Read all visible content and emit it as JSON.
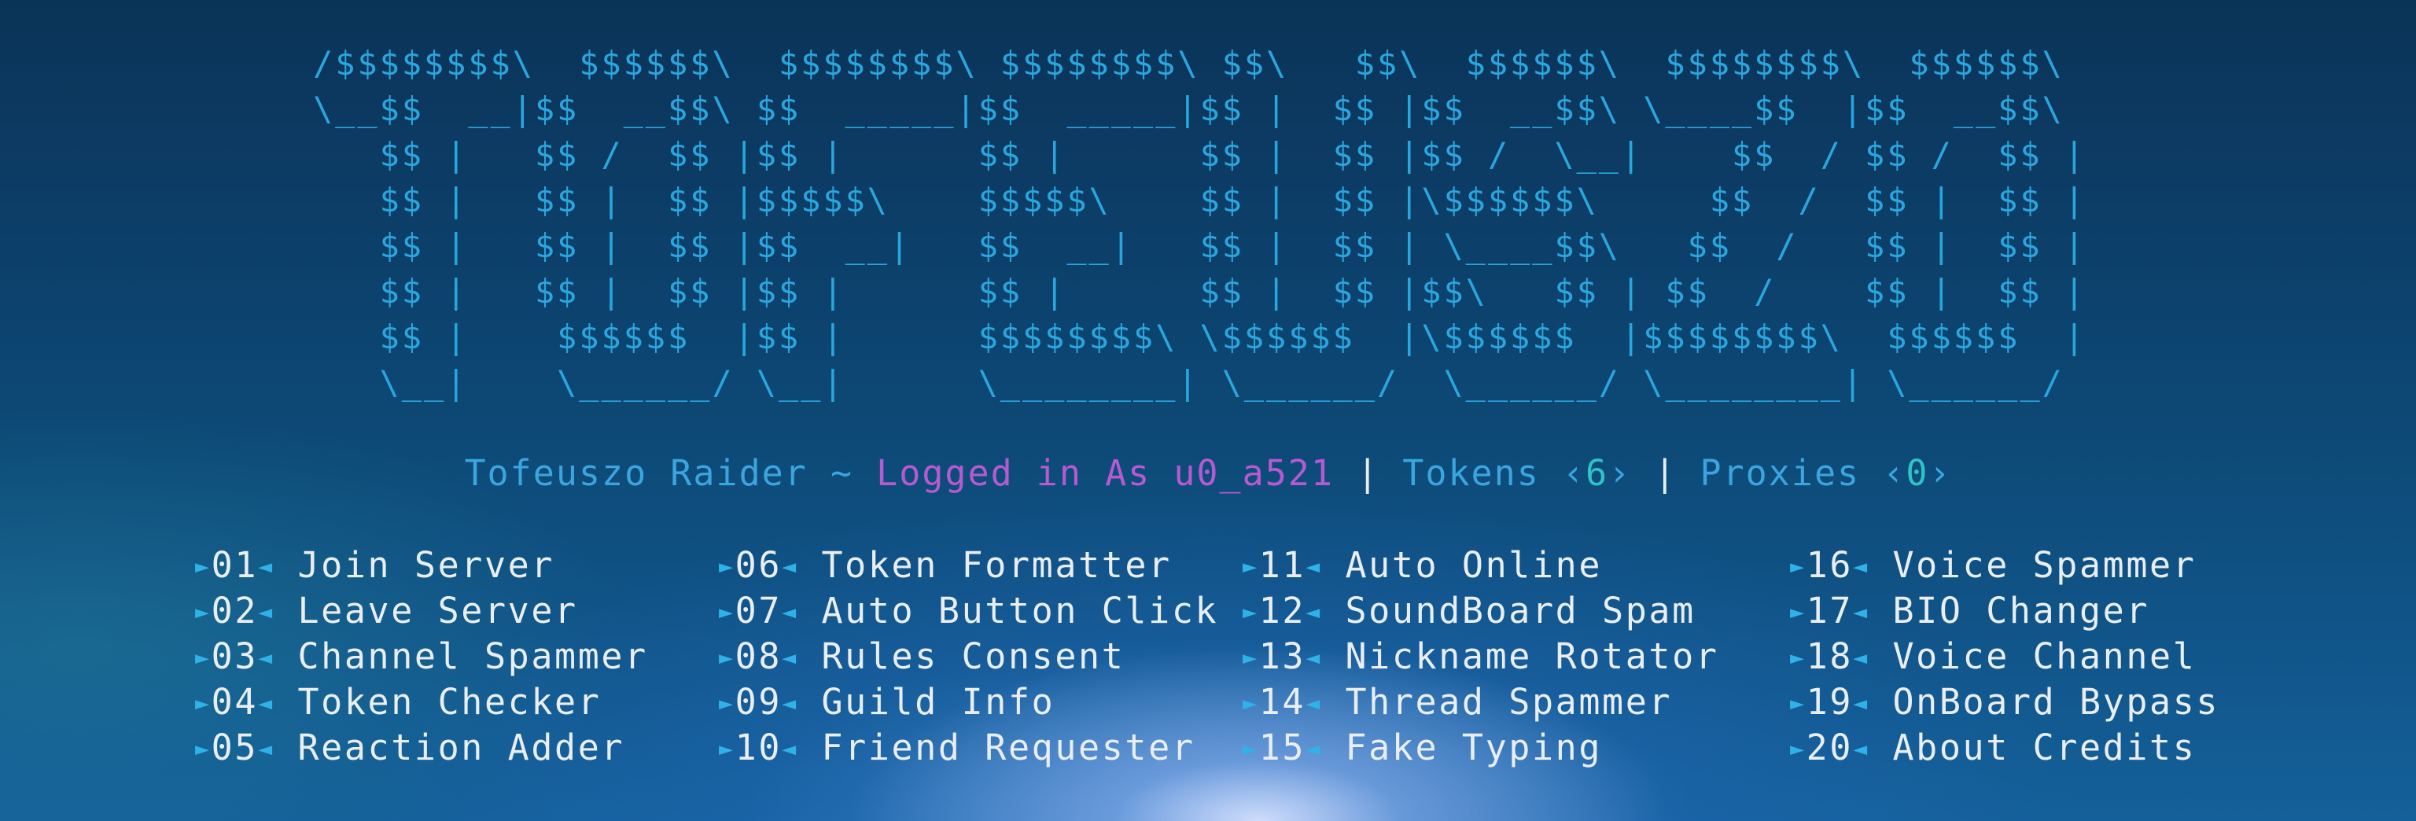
{
  "banner": {
    "lines": [
      "/$$$$$$$$\\  $$$$$$\\  $$$$$$$$\\ $$$$$$$$\\ $$\\   $$\\  $$$$$$\\  $$$$$$$$\\  $$$$$$\\",
      "\\__$$  __|$$  __$$\\ $$  _____|$$  _____|$$ |  $$ |$$  __$$\\ \\____$$  |$$  __$$\\",
      "   $$ |   $$ /  $$ |$$ |      $$ |      $$ |  $$ |$$ /  \\__|    $$  / $$ /  $$ |",
      "   $$ |   $$ |  $$ |$$$$$\\    $$$$$\\    $$ |  $$ |\\$$$$$$\\     $$  /  $$ |  $$ |",
      "   $$ |   $$ |  $$ |$$  __|   $$  __|   $$ |  $$ | \\____$$\\   $$  /   $$ |  $$ |",
      "   $$ |   $$ |  $$ |$$ |      $$ |      $$ |  $$ |$$\\   $$ | $$  /    $$ |  $$ |",
      "   $$ |    $$$$$$  |$$ |      $$$$$$$$\\ \\$$$$$$  |\\$$$$$$  |$$$$$$$$\\  $$$$$$  |",
      "   \\__|    \\______/ \\__|      \\________| \\______/  \\______/ \\________| \\______/"
    ]
  },
  "status": {
    "app_name": "Tofeuszo Raider",
    "separator_tilde": " ~ ",
    "logged_in": "Logged in As u0_a521",
    "pipe": " | ",
    "tokens_label": "Tokens ",
    "tokens_open": "‹",
    "tokens_count": "6",
    "tokens_close": "›",
    "proxies_label": "Proxies ",
    "proxies_open": "‹",
    "proxies_count": "0",
    "proxies_close": "›"
  },
  "menu": {
    "arrow_left": "►",
    "arrow_right": "◄",
    "columns": [
      [
        {
          "num": "01",
          "label": "Join Server"
        },
        {
          "num": "02",
          "label": "Leave Server"
        },
        {
          "num": "03",
          "label": "Channel Spammer"
        },
        {
          "num": "04",
          "label": "Token Checker"
        },
        {
          "num": "05",
          "label": "Reaction Adder"
        }
      ],
      [
        {
          "num": "06",
          "label": "Token Formatter"
        },
        {
          "num": "07",
          "label": "Auto Button Click"
        },
        {
          "num": "08",
          "label": "Rules Consent"
        },
        {
          "num": "09",
          "label": "Guild Info"
        },
        {
          "num": "10",
          "label": "Friend Requester"
        }
      ],
      [
        {
          "num": "11",
          "label": "Auto Online"
        },
        {
          "num": "12",
          "label": "SoundBoard Spam"
        },
        {
          "num": "13",
          "label": "Nickname Rotator"
        },
        {
          "num": "14",
          "label": "Thread Spammer"
        },
        {
          "num": "15",
          "label": "Fake Typing"
        }
      ],
      [
        {
          "num": "16",
          "label": "Voice Spammer"
        },
        {
          "num": "17",
          "label": "BIO Changer"
        },
        {
          "num": "18",
          "label": "Voice Channel"
        },
        {
          "num": "19",
          "label": "OnBoard Bypass"
        },
        {
          "num": "20",
          "label": "About Credits"
        }
      ]
    ]
  },
  "colors": {
    "banner": "#2aa6de",
    "app_name": "#3aa5de",
    "logged_in": "#b65ad0",
    "counts": "#2fc3c8",
    "menu_text": "#e9eef3",
    "arrows": "#2fb2e8"
  }
}
